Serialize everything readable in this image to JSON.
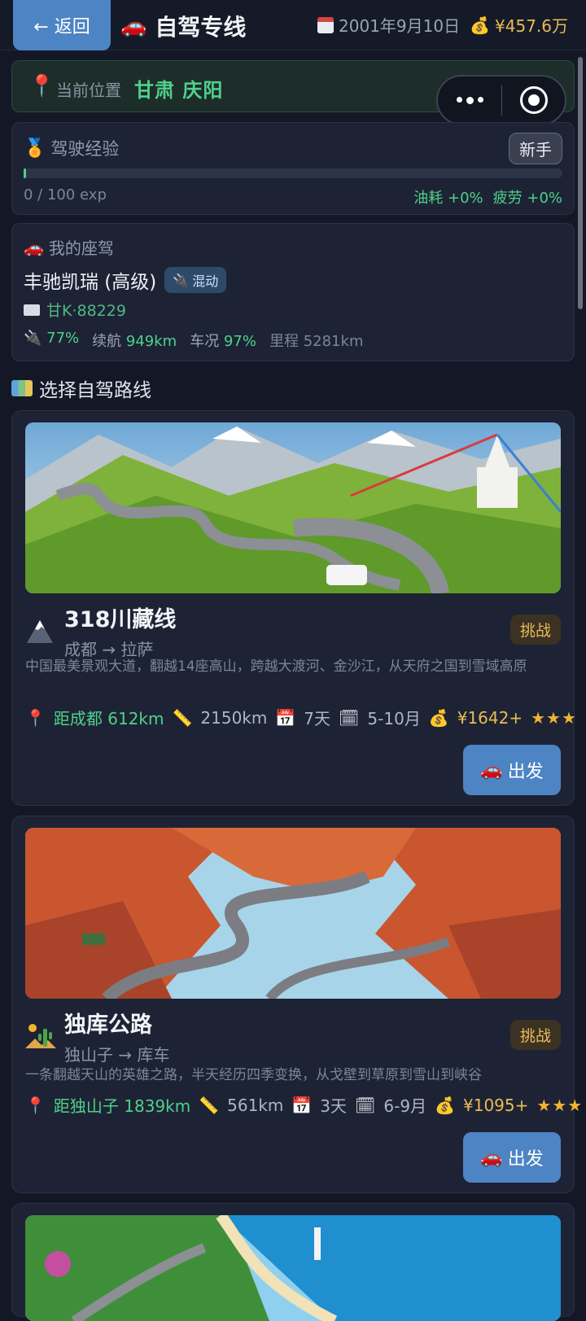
{
  "header": {
    "back_label": "← 返回",
    "title": "自驾专线",
    "date": "2001年9月10日",
    "money": "¥457.6万"
  },
  "location": {
    "label": "当前位置",
    "value": "甘肃 庆阳"
  },
  "experience": {
    "title": "驾驶经验",
    "level": "新手",
    "progress_text": "0 / 100 exp",
    "progress": 0,
    "fuel_bonus": "油耗 +0%",
    "fatigue_bonus": "疲劳 +0%"
  },
  "car": {
    "title": "我的座驾",
    "model": "丰驰凯瑞 (高级)",
    "type_tag": "混动",
    "plate": "甘K·88229",
    "battery": "77%",
    "range_label": "续航",
    "range_value": "949km",
    "condition_label": "车况",
    "condition_value": "97%",
    "mileage": "里程 5281km"
  },
  "routes_title": "选择自驾路线",
  "routes": [
    {
      "name": "318川藏线",
      "path": "成都 → 拉萨",
      "difficulty": "挑战",
      "desc": "中国最美景观大道，翻越14座高山，跨越大渡河、金沙江，从天府之国到雪域高原",
      "distance_from": "距成都 612km",
      "length": "2150km",
      "days": "7天",
      "season": "5-10月",
      "cost": "¥1642+",
      "stars": "★★★",
      "go_label": "出发"
    },
    {
      "name": "独库公路",
      "path": "独山子 → 库车",
      "difficulty": "挑战",
      "desc": "一条翻越天山的英雄之路，半天经历四季变换，从戈壁到草原到雪山到峡谷",
      "distance_from": "距独山子 1839km",
      "length": "561km",
      "days": "3天",
      "season": "6-9月",
      "cost": "¥1095+",
      "stars": "★★★",
      "go_label": "出发"
    }
  ],
  "colors": {
    "accent": "#4d84c4",
    "green": "#4fd18b",
    "gold": "#e9bb55",
    "background": "#141826"
  }
}
